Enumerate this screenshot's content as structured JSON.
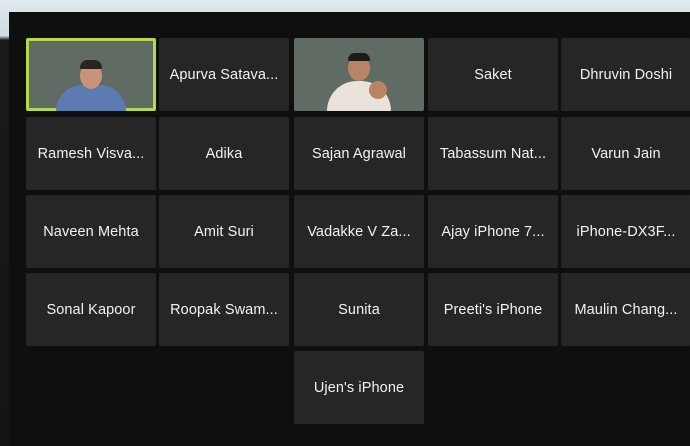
{
  "participants": [
    {
      "name": "",
      "type": "video",
      "active": true
    },
    {
      "name": "Apurva Satava...",
      "type": "name"
    },
    {
      "name": "",
      "type": "video"
    },
    {
      "name": "Saket",
      "type": "name"
    },
    {
      "name": "Dhruvin Doshi",
      "type": "name"
    },
    {
      "name": "Ramesh Visva...",
      "type": "name"
    },
    {
      "name": "Adika",
      "type": "name"
    },
    {
      "name": "Sajan Agrawal",
      "type": "name"
    },
    {
      "name": "Tabassum Nat...",
      "type": "name"
    },
    {
      "name": "Varun Jain",
      "type": "name"
    },
    {
      "name": "Naveen Mehta",
      "type": "name"
    },
    {
      "name": "Amit Suri",
      "type": "name"
    },
    {
      "name": "Vadakke V Za...",
      "type": "name"
    },
    {
      "name": "Ajay iPhone 7...",
      "type": "name"
    },
    {
      "name": "iPhone-DX3F...",
      "type": "name"
    },
    {
      "name": "Sonal Kapoor",
      "type": "name"
    },
    {
      "name": "Roopak Swam...",
      "type": "name"
    },
    {
      "name": "Sunita",
      "type": "name"
    },
    {
      "name": "Preeti's iPhone",
      "type": "name"
    },
    {
      "name": "Maulin Chang...",
      "type": "name"
    },
    {
      "name": "Ujen's iPhone",
      "type": "name"
    }
  ],
  "colors": {
    "active_speaker_border": "#b6d84a",
    "tile_bg": "#262626",
    "screen_bg": "#0f0f0f"
  }
}
